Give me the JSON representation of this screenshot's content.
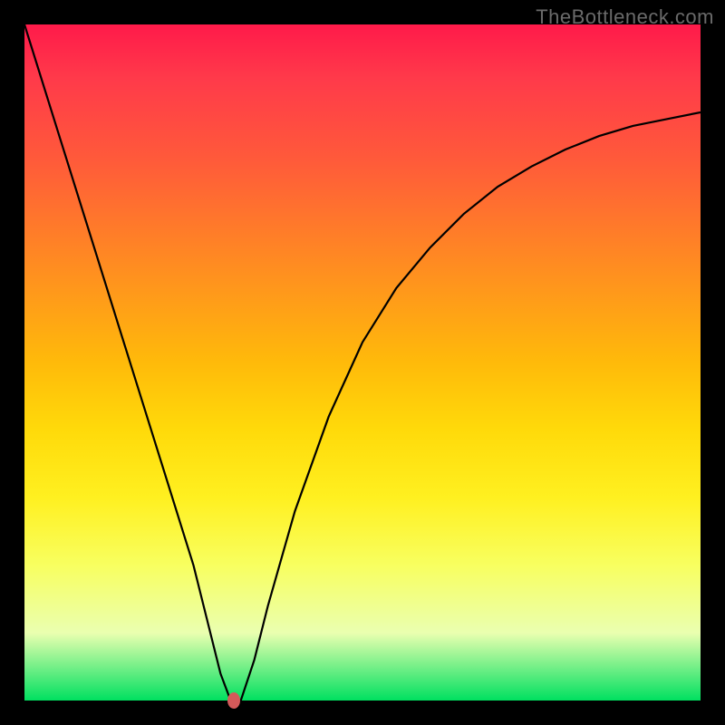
{
  "watermark": "TheBottleneck.com",
  "chart_data": {
    "type": "line",
    "title": "",
    "xlabel": "",
    "ylabel": "",
    "xlim": [
      0,
      100
    ],
    "ylim": [
      0,
      100
    ],
    "series": [
      {
        "name": "bottleneck-curve",
        "x": [
          0,
          5,
          10,
          15,
          20,
          25,
          27,
          29,
          30.5,
          32,
          34,
          36,
          40,
          45,
          50,
          55,
          60,
          65,
          70,
          75,
          80,
          85,
          90,
          95,
          100
        ],
        "y": [
          100,
          84,
          68,
          52,
          36,
          20,
          12,
          4,
          0,
          0,
          6,
          14,
          28,
          42,
          53,
          61,
          67,
          72,
          76,
          79,
          81.5,
          83.5,
          85,
          86,
          87
        ]
      }
    ],
    "marker": {
      "x": 31,
      "y": 0,
      "color": "#d45a5a"
    },
    "gradient_stops": [
      {
        "pct": 0,
        "color": "#ff1a4a"
      },
      {
        "pct": 50,
        "color": "#ffda0a"
      },
      {
        "pct": 100,
        "color": "#00e060"
      }
    ]
  }
}
